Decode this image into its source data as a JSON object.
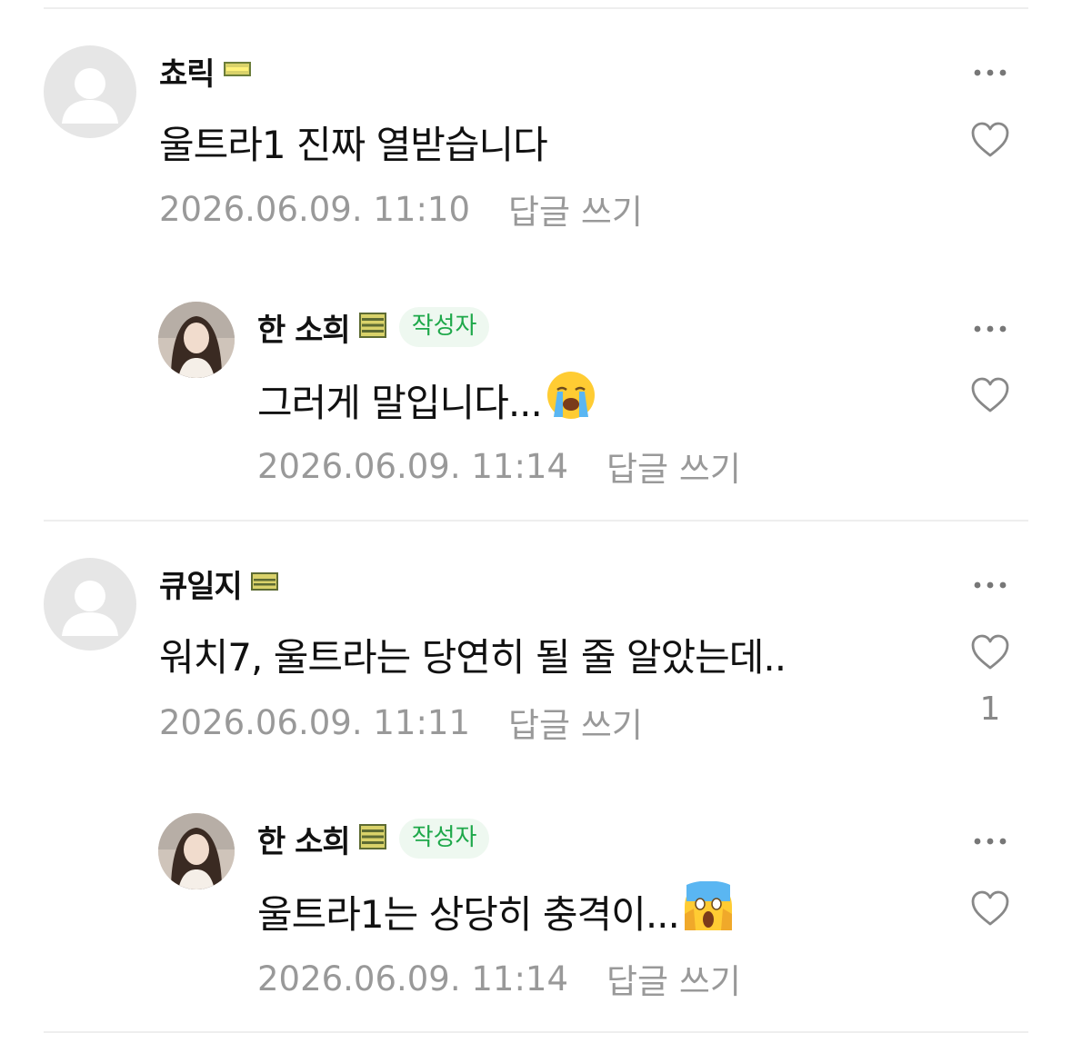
{
  "comments": [
    {
      "nickname": "쵸릭",
      "text": "울트라1 진짜 열받습니다",
      "date": "2026.06.09. 11:10",
      "reply_label": "답글 쓰기",
      "avatar": "default-avatar-icon"
    },
    {
      "nickname": "한 소희",
      "author_tag": "작성자",
      "text": "그러게 말입니다...",
      "emoji": "loudly-crying-face",
      "date": "2026.06.09. 11:14",
      "reply_label": "답글 쓰기"
    },
    {
      "nickname": "큐일지",
      "text": "워치7, 울트라는 당연히 될 줄 알았는데..",
      "date": "2026.06.09. 11:11",
      "reply_label": "답글 쓰기",
      "like_count": "1",
      "avatar": "default-avatar-icon"
    },
    {
      "nickname": "한 소희",
      "author_tag": "작성자",
      "text": "울트라1는 상당히 충격이...",
      "emoji": "screaming-face",
      "date": "2026.06.09. 11:14",
      "reply_label": "답글 쓰기"
    }
  ],
  "colors": {
    "author_tag_bg": "#eef8f0",
    "author_tag_text": "#1ea84a",
    "meta_text": "#999999",
    "level_badge": "#d9d26a"
  }
}
